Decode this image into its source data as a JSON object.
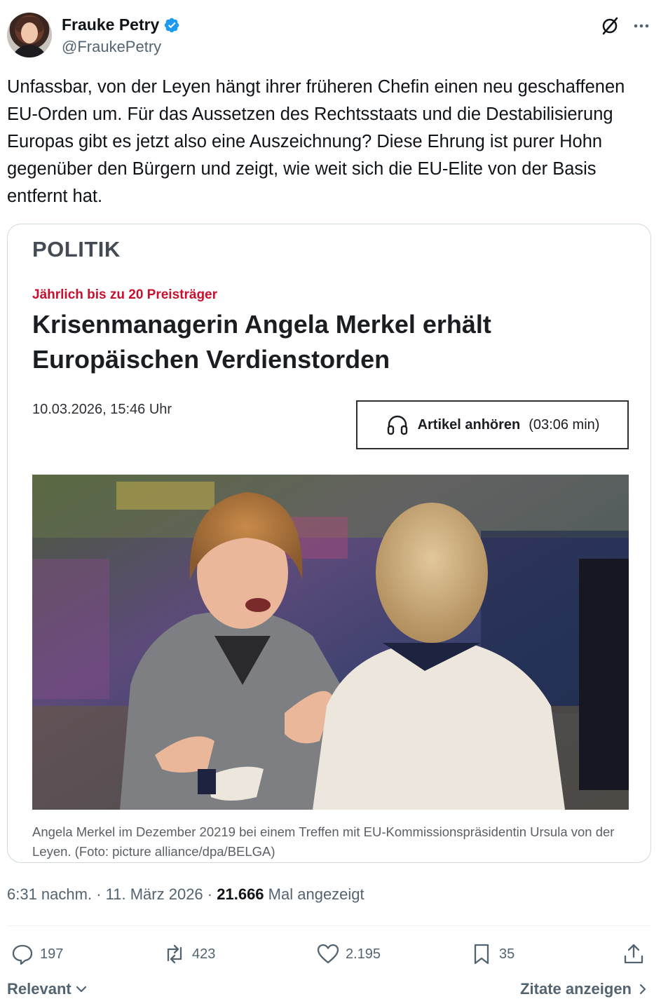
{
  "author": {
    "name": "Frauke Petry",
    "handle": "@FraukePetry",
    "verified": true,
    "verified_color": "#1d9bf0"
  },
  "header_icons": [
    "grok-icon",
    "more-icon"
  ],
  "tweet": {
    "text": "Unfassbar, von der Leyen hängt ihrer früheren Chefin einen neu geschaffenen EU-Orden um. Für das Aussetzen des Rechtsstaats und die Destabilisierung Europas gibt es jetzt also eine Auszeichnung? Diese Ehrung ist purer Hohn gegenüber den Bürgern und zeigt, wie weit sich die EU-Elite von der Basis entfernt hat."
  },
  "card": {
    "section": "POLITIK",
    "kicker": "Jährlich bis zu 20 Preisträger",
    "headline": "Krisenmanagerin Angela Merkel erhält Europäischen Verdienstorden",
    "date": "10.03.2026, 15:46 Uhr",
    "listen_label": "Artikel anhören",
    "listen_duration": "(03:06 min)",
    "caption": "Angela Merkel im Dezember 20219 bei einem Treffen mit EU-Kommissionspräsidentin Ursula von der Leyen. (Foto: picture alliance/dpa/BELGA)",
    "kicker_color": "#c8102e"
  },
  "meta": {
    "time": "6:31 nachm.",
    "date": "11. März 2026",
    "views": "21.666",
    "views_label": "Mal angezeigt"
  },
  "actions": {
    "replies": "197",
    "reposts": "423",
    "likes": "2.195",
    "bookmarks": "35"
  },
  "footer": {
    "sort_label": "Relevant",
    "quotes_label": "Zitate anzeigen"
  }
}
